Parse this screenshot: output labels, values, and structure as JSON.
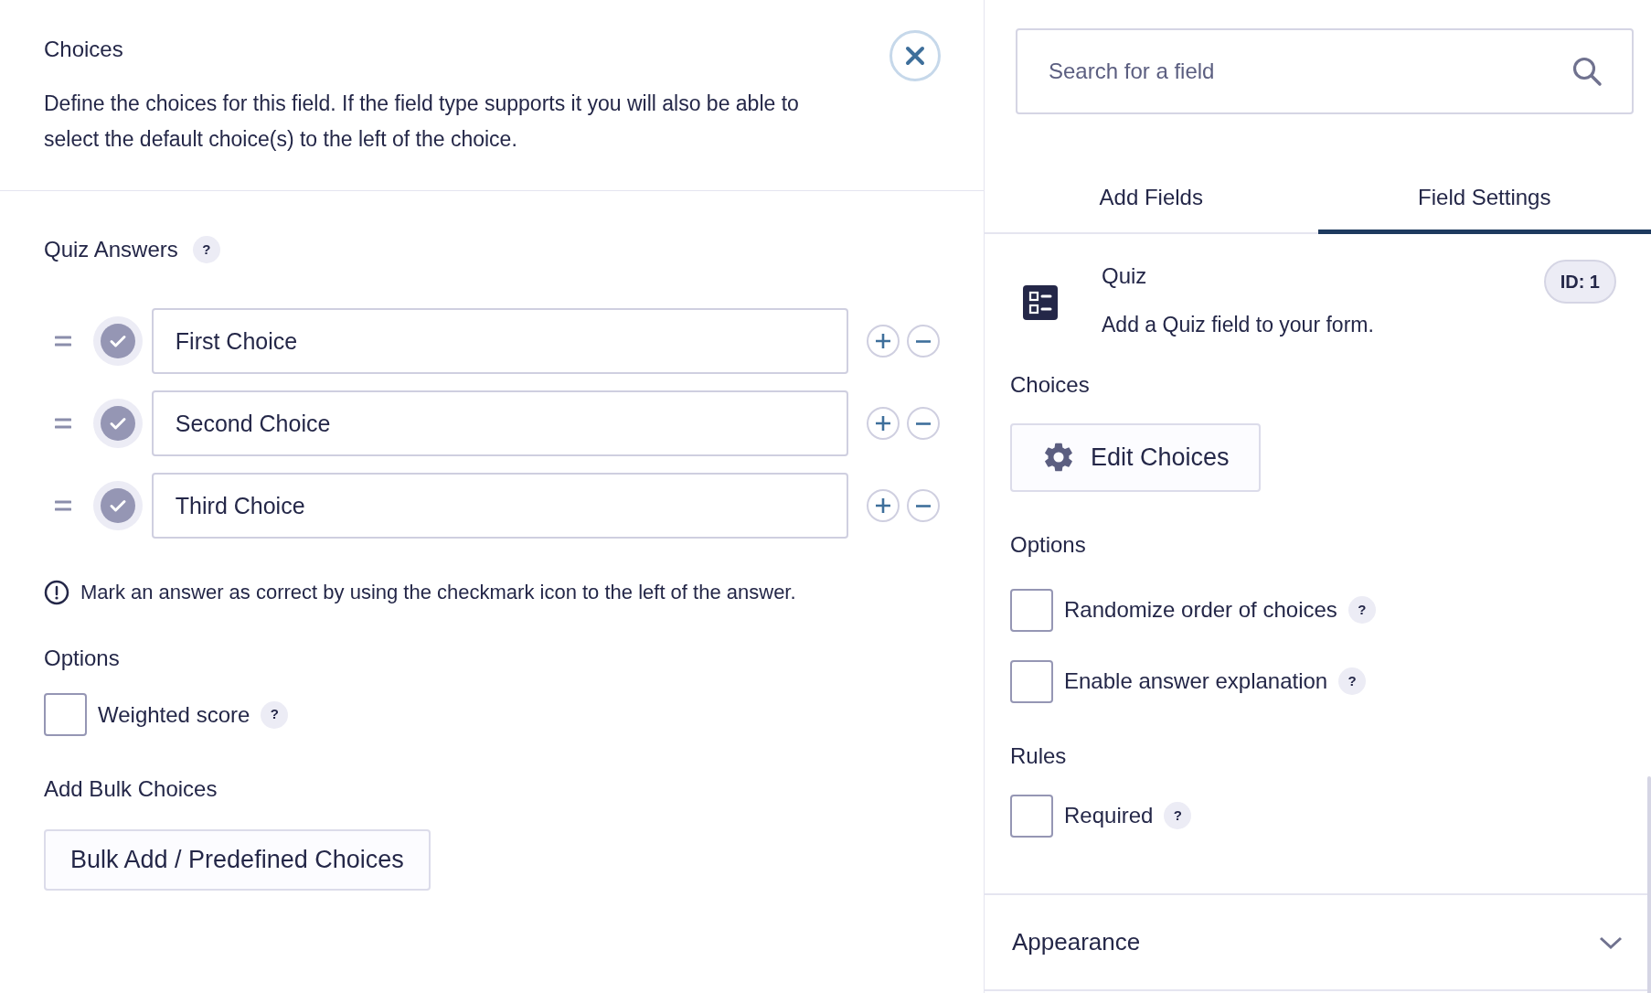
{
  "left": {
    "title": "Choices",
    "description": "Define the choices for this field. If the field type supports it you will also be able to select the default choice(s) to the left of the choice.",
    "quiz_answers": {
      "label": "Quiz Answers",
      "help": "?",
      "choices": [
        {
          "value": "First Choice",
          "correct": false
        },
        {
          "value": "Second Choice",
          "correct": false
        },
        {
          "value": "Third Choice",
          "correct": false
        }
      ]
    },
    "note": "Mark an answer as correct by using the checkmark icon to the left of the answer.",
    "options_label": "Options",
    "options": [
      {
        "label": "Weighted score",
        "checked": false,
        "help": "?"
      }
    ],
    "bulk_label": "Add Bulk Choices",
    "bulk_button": "Bulk Add / Predefined Choices"
  },
  "right": {
    "search": {
      "placeholder": "Search for a field"
    },
    "tabs": [
      {
        "label": "Add Fields",
        "selected": false
      },
      {
        "label": "Field Settings",
        "selected": true
      }
    ],
    "field": {
      "name": "Quiz",
      "description": "Add a Quiz field to your form.",
      "id_badge": "ID: 1"
    },
    "choices_label": "Choices",
    "edit_button": "Edit Choices",
    "options_label": "Options",
    "options": [
      {
        "label": "Randomize order of choices",
        "checked": false,
        "help": "?"
      },
      {
        "label": "Enable answer explanation",
        "checked": false,
        "help": "?"
      }
    ],
    "rules_label": "Rules",
    "rules": [
      {
        "label": "Required",
        "checked": false,
        "help": "?"
      }
    ],
    "appearance": {
      "label": "Appearance",
      "expanded": false
    }
  }
}
